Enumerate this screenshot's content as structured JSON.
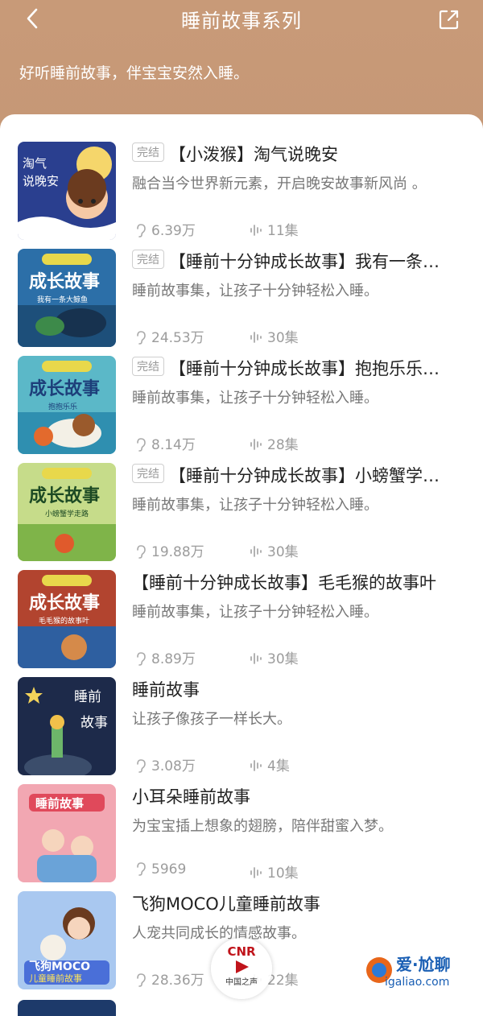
{
  "header": {
    "title": "睡前故事系列",
    "subtitle": "好听睡前故事，伴宝宝安然入睡。"
  },
  "items": [
    {
      "badge": "完结",
      "title": "【小泼猴】淘气说晚安",
      "desc": "融合当今世界新元素，开启晚安故事新风尚 。",
      "plays": "6.39万",
      "episodes": "11集",
      "cover_color": "#2a3f8f"
    },
    {
      "badge": "完结",
      "title": "【睡前十分钟成长故事】我有一条…",
      "desc": "睡前故事集，让孩子十分钟轻松入睡。",
      "plays": "24.53万",
      "episodes": "30集",
      "cover_color": "#2c6fa8"
    },
    {
      "badge": "完结",
      "title": "【睡前十分钟成长故事】抱抱乐乐…",
      "desc": "睡前故事集，让孩子十分钟轻松入睡。",
      "plays": "8.14万",
      "episodes": "28集",
      "cover_color": "#5bb8c8"
    },
    {
      "badge": "完结",
      "title": "【睡前十分钟成长故事】小螃蟹学…",
      "desc": "睡前故事集，让孩子十分钟轻松入睡。",
      "plays": "19.88万",
      "episodes": "30集",
      "cover_color": "#c6dc8a"
    },
    {
      "badge": "",
      "title": "【睡前十分钟成长故事】毛毛猴的故事叶",
      "desc": "睡前故事集，让孩子十分钟轻松入睡。",
      "plays": "8.89万",
      "episodes": "30集",
      "cover_color": "#b2442f"
    },
    {
      "badge": "",
      "title": "睡前故事",
      "desc": "让孩子像孩子一样长大。",
      "plays": "3.08万",
      "episodes": "4集",
      "cover_color": "#1d2a4a"
    },
    {
      "badge": "",
      "title": "小耳朵睡前故事",
      "desc": "为宝宝插上想象的翅膀，陪伴甜蜜入梦。",
      "plays": "5969",
      "episodes": "10集",
      "cover_color": "#f2a7b2"
    },
    {
      "badge": "",
      "title": "飞狗MOCO儿童睡前故事",
      "desc": "人宠共同成长的情感故事。",
      "plays": "28.36万",
      "episodes": "22集",
      "cover_color": "#a9c8f0"
    }
  ],
  "covers": [
    {
      "line1": "淘气",
      "line2": "说晚安"
    },
    {
      "line1": "成长故事",
      "line2": "我有一条大鲸鱼"
    },
    {
      "line1": "成长故事",
      "line2": "抱抱乐乐"
    },
    {
      "line1": "成长故事",
      "line2": "小螃蟹学走路"
    },
    {
      "line1": "成长故事",
      "line2": "毛毛猴的故事叶"
    },
    {
      "line1": "睡前",
      "line2": "故事"
    },
    {
      "line1": "睡前故事",
      "line2": ""
    },
    {
      "line1": "飞狗MOCO",
      "line2": "儿童睡前故事"
    }
  ],
  "overlay": {
    "cnr": "CNR",
    "cnr_sub": "中国之声",
    "watermark": "爱·尬聊",
    "watermark_url": "igaliao.com"
  }
}
